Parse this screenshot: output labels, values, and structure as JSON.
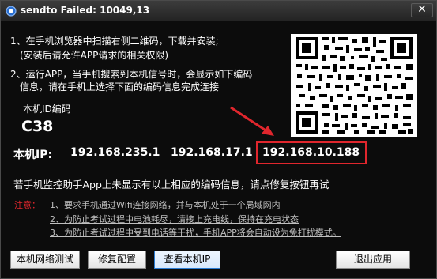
{
  "window": {
    "title": "sendto Failed: 10049,13",
    "close_glyph": "✕"
  },
  "instructions": {
    "line1": "1、在手机浏览器中扫描右侧二维码，下载并安装;",
    "line1_sub": "(安装后请允许APP请求的相关权限)",
    "line2": "2、运行APP，当手机搜索到本机信号时，会显示如下编码",
    "line2_sub": "信息，请在手机上选择下面的编码信息完成连接"
  },
  "device": {
    "id_label": "本机ID编码",
    "id_value": "C38",
    "ip_label": "本机IP:",
    "ips": [
      "192.168.235.1",
      "192.168.17.1",
      "192.168.10.188"
    ]
  },
  "hint": "若手机监控助手App上未显示有以上相应的编码信息，请点修复按钮再试",
  "notes": {
    "label": "注意：",
    "items": [
      "1、要求手机通过Wifi连接网络，并与本机处于一个局域网内",
      "2、为防止考试过程中电池耗尽，请接上充电线，保持在充电状态",
      "3、为防止考试过程中受到电话等干扰，手机APP将会自动设为免打扰模式。"
    ]
  },
  "buttons": {
    "network_test": "本机网络测试",
    "repair_config": "修复配置",
    "view_ip": "查看本机IP",
    "exit_app": "退出应用"
  },
  "colors": {
    "highlight": "#e0262d",
    "background": "#0c0c0c",
    "accent_button": "#2b7cd3"
  },
  "icons": [
    "app-icon",
    "close-icon",
    "qr-code",
    "red-arrow"
  ]
}
